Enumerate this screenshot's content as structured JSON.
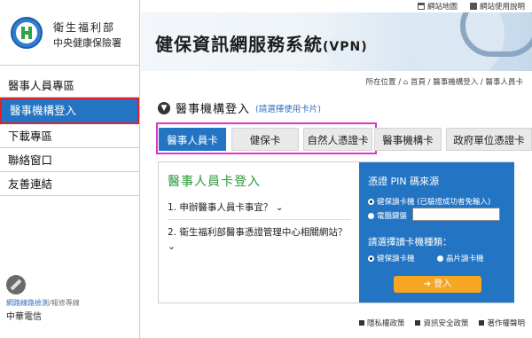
{
  "top_links": {
    "sitemap": "網站地圖",
    "usage": "網站使用說明"
  },
  "logo": {
    "line1": "衛生福利部",
    "line2": "中央健康保險署"
  },
  "banner": {
    "title": "健保資訊網服務系統",
    "suffix": "(VPN)"
  },
  "sidebar": {
    "items": [
      {
        "label": "醫事人員專區"
      },
      {
        "label": "醫事機構登入"
      },
      {
        "label": "下載專區"
      },
      {
        "label": "聯絡窗口"
      },
      {
        "label": "友善連結"
      }
    ],
    "active_index": 1,
    "net_check_link": "網路線路檢測",
    "net_repair_link": "報修專線",
    "net_separator": "/",
    "isp": "中華電信"
  },
  "breadcrumb": {
    "prefix": "所在位置 /",
    "home": "首頁",
    "trail": "/ 醫事機構登入 / 醫事人員卡"
  },
  "section": {
    "title": "醫事機構登入",
    "hint": "(請選擇使用卡片)"
  },
  "tabs": [
    {
      "label": "醫事人員卡"
    },
    {
      "label": "健保卡"
    },
    {
      "label": "自然人憑證卡"
    },
    {
      "label": "醫事機構卡"
    },
    {
      "label": "政府單位憑證卡"
    }
  ],
  "login_card": {
    "title": "醫事人員卡登入",
    "faq1": "1. 申辦醫事人員卡事宜？ ⌄",
    "faq2": "2. 衛生福利部醫事憑證管理中心相關網站？ ⌄",
    "pin_title": "憑證 PIN 碼來源",
    "pin_opt1": "健保讀卡機 (已驗證成功者免輸入)",
    "pin_opt2": "電腦鍵盤",
    "reader_title": "請選擇讀卡機種類：",
    "reader_opt1": "健保讀卡機",
    "reader_opt2": "晶片讀卡機",
    "login_button": "登入"
  },
  "footer": {
    "privacy": "隱私權政策",
    "security": "資訊安全政策",
    "copyright": "著作權聲明"
  },
  "colors": {
    "accent": "#2374c2",
    "login_button": "#f5a623",
    "title_green": "#2c9a3b",
    "sidebar_highlight": "#e0202a",
    "tab_highlight": "#e035c9"
  }
}
